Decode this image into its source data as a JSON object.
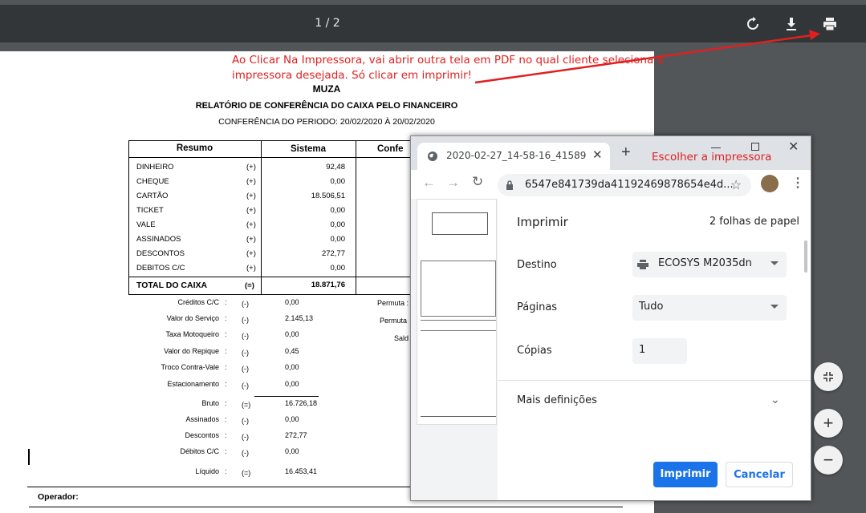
{
  "viewer": {
    "page_indicator": "1 / 2"
  },
  "annotations": {
    "note1_line1": "Ao Clicar Na Impressora, vai abrir outra tela em PDF no qual cliente seleciona a",
    "note1_line2": "impressora desejada. Só clicar em imprimir!",
    "note2": "Escolher a impressora",
    "color": "#e02020"
  },
  "report": {
    "company": "MUZA",
    "title": "RELATÓRIO DE CONFERÊNCIA DO CAIXA PELO FINANCEIRO",
    "period": "CONFERÊNCIA DO PERIODO: 20/02/2020 À 20/02/2020",
    "headers": [
      "Resumo",
      "Sistema",
      "Confe"
    ],
    "rows": [
      {
        "name": "DINHEIRO",
        "sign": "(+)",
        "value": "92,48"
      },
      {
        "name": "CHEQUE",
        "sign": "(+)",
        "value": "0,00"
      },
      {
        "name": "CARTÃO",
        "sign": "(+)",
        "value": "18.506,51"
      },
      {
        "name": "TICKET",
        "sign": "(+)",
        "value": "0,00"
      },
      {
        "name": "VALE",
        "sign": "(+)",
        "value": "0,00"
      },
      {
        "name": "ASSINADOS",
        "sign": "(+)",
        "value": "0,00"
      },
      {
        "name": "DESCONTOS",
        "sign": "(+)",
        "value": "272,77"
      },
      {
        "name": "DEBITOS C/C",
        "sign": "(+)",
        "value": "0,00"
      }
    ],
    "total": {
      "name": "TOTAL DO CAIXA",
      "sign": "(=)",
      "value": "18.871,76"
    },
    "details": [
      {
        "name": "Créditos C/C",
        "colon": ":",
        "sign": "(-)",
        "value": "0,00"
      },
      {
        "name": "Valor do Serviço",
        "colon": ":",
        "sign": "(-)",
        "value": "2.145,13"
      },
      {
        "name": "Taxa Motoqueiro",
        "colon": ":",
        "sign": "(-)",
        "value": "0,00"
      },
      {
        "name": "Valor do Repique",
        "colon": ":",
        "sign": "(-)",
        "value": "0,45"
      },
      {
        "name": "Troco Contra-Vale",
        "colon": ":",
        "sign": "(-)",
        "value": "0,00"
      },
      {
        "name": "Estacionamento",
        "colon": ":",
        "sign": "(-)",
        "value": "0,00"
      },
      {
        "name": "Bruto",
        "colon": ":",
        "sign": "(=)",
        "value": "16.726,18"
      },
      {
        "name": "Assinados",
        "colon": ":",
        "sign": "(-)",
        "value": "0,00"
      },
      {
        "name": "Descontos",
        "colon": ":",
        "sign": "(-)",
        "value": "272,77"
      },
      {
        "name": "Débitos C/C",
        "colon": ":",
        "sign": "(-)",
        "value": "0,00"
      },
      {
        "name": "Líquido",
        "colon": ":",
        "sign": "(=)",
        "value": "16.453,41"
      }
    ],
    "side_labels": [
      "Permuta :",
      "Permuta",
      "Sald"
    ],
    "operator": "Operador:"
  },
  "dialog": {
    "tab_title": "2020-02-27_14-58-16_41589",
    "url": "6547e841739da41192469878654e4d...",
    "print_title": "Imprimir",
    "sheets": "2 folhas de papel",
    "destination_label": "Destino",
    "destination_value": "ECOSYS M2035dn",
    "pages_label": "Páginas",
    "pages_value": "Tudo",
    "copies_label": "Cópias",
    "copies_value": "1",
    "more_settings": "Mais definições",
    "print_button": "Imprimir",
    "cancel_button": "Cancelar",
    "accent": "#1a73e8"
  },
  "zoom": {
    "fit": "fit-icon",
    "zoom_in": "+",
    "zoom_out": "−"
  }
}
